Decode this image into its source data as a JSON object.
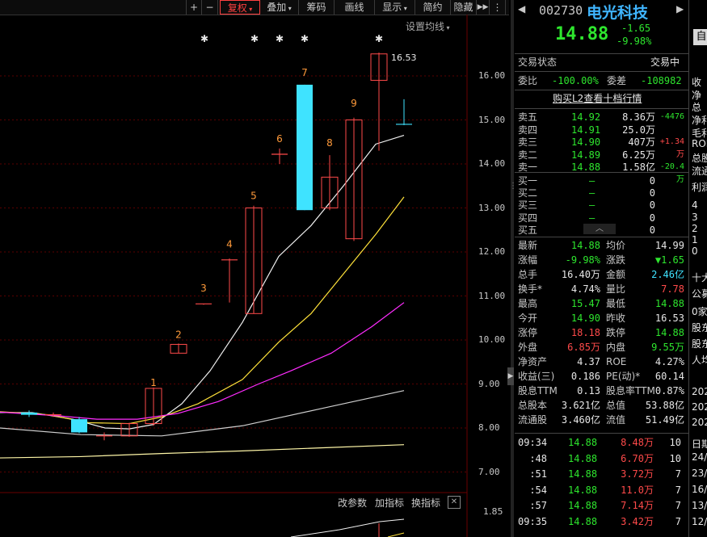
{
  "toolbar": {
    "plus": "+",
    "minus": "−",
    "fuquan": "复权",
    "diejia": "叠加",
    "chouma": "筹码",
    "huaxian": "画线",
    "xianshi": "显示",
    "jianyue": "简约",
    "yincang": "隐藏",
    "nav": "▶▶",
    "more": "⋮"
  },
  "chart": {
    "setting_ma": "设置均线",
    "price_ticks": [
      "16.00",
      "15.00",
      "14.00",
      "13.00",
      "12.00",
      "11.00",
      "10.00",
      "9.00",
      "8.00",
      "7.00"
    ],
    "high_label": "16.53",
    "candle_numbers": [
      "1",
      "2",
      "3",
      "4",
      "5",
      "6",
      "7",
      "8",
      "9"
    ],
    "star": "✱",
    "bottom_tools": {
      "gaicanshu": "改参数",
      "jiazhibiao": "加指标",
      "huanzhibiao": "换指标",
      "close": "✕"
    },
    "indicator_tick": "1.85"
  },
  "stock": {
    "code": "002730",
    "name": "电光科技",
    "price": "14.88",
    "change": "-1.65",
    "pct": "-9.98%",
    "side_btn": "自"
  },
  "status": {
    "label": "交易状态",
    "value": "交易中"
  },
  "weibi": {
    "label": "委比",
    "value": "-100.00%",
    "label2": "委差",
    "value2": "-108982"
  },
  "l2_link": "购买L2查看十档行情",
  "sell": [
    {
      "label": "卖五",
      "price": "14.92",
      "vol": "8.36万",
      "chg": "-4476"
    },
    {
      "label": "卖四",
      "price": "14.91",
      "vol": "25.0万",
      "chg": ""
    },
    {
      "label": "卖三",
      "price": "14.90",
      "vol": "407万",
      "chg": "+1.34万"
    },
    {
      "label": "卖二",
      "price": "14.89",
      "vol": "6.25万",
      "chg": ""
    },
    {
      "label": "卖一",
      "price": "14.88",
      "vol": "1.58亿",
      "chg": "-20.4万"
    }
  ],
  "buy": [
    {
      "label": "买一",
      "price": "—",
      "vol": "0"
    },
    {
      "label": "买二",
      "price": "—",
      "vol": "0"
    },
    {
      "label": "买三",
      "price": "—",
      "vol": "0"
    },
    {
      "label": "买四",
      "price": "—",
      "vol": "0"
    },
    {
      "label": "买五",
      "price": "—",
      "vol": "0"
    }
  ],
  "quote": [
    {
      "l1": "最新",
      "v1": "14.88",
      "c1": "green",
      "l2": "均价",
      "v2": "14.99",
      "c2": "white"
    },
    {
      "l1": "涨幅",
      "v1": "-9.98%",
      "c1": "green",
      "l2": "涨跌",
      "v2": "▼1.65",
      "c2": "green"
    },
    {
      "l1": "总手",
      "v1": "16.40万",
      "c1": "white",
      "l2": "金额",
      "v2": "2.46亿",
      "c2": "cyan"
    },
    {
      "l1": "换手*",
      "v1": "4.74%",
      "c1": "white",
      "l2": "量比",
      "v2": "7.78",
      "c2": "red"
    },
    {
      "l1": "最高",
      "v1": "15.47",
      "c1": "green",
      "l2": "最低",
      "v2": "14.88",
      "c2": "green"
    },
    {
      "l1": "今开",
      "v1": "14.90",
      "c1": "green",
      "l2": "昨收",
      "v2": "16.53",
      "c2": "white"
    },
    {
      "l1": "涨停",
      "v1": "18.18",
      "c1": "red",
      "l2": "跌停",
      "v2": "14.88",
      "c2": "green"
    },
    {
      "l1": "外盘",
      "v1": "6.85万",
      "c1": "red",
      "l2": "内盘",
      "v2": "9.55万",
      "c2": "green"
    },
    {
      "l1": "净资产",
      "v1": "4.37",
      "c1": "white",
      "l2": "ROE",
      "v2": "4.27%",
      "c2": "white"
    },
    {
      "l1": "收益(三)",
      "v1": "0.186",
      "c1": "white",
      "l2": "PE(动)*",
      "v2": "60.14",
      "c2": "white"
    },
    {
      "l1": "股息TTM",
      "v1": "0.13",
      "c1": "white",
      "l2": "股息率TTM",
      "v2": "0.87%",
      "c2": "white"
    },
    {
      "l1": "总股本",
      "v1": "3.621亿",
      "c1": "white",
      "l2": "总值",
      "v2": "53.88亿",
      "c2": "white"
    },
    {
      "l1": "流通股",
      "v1": "3.460亿",
      "c1": "white",
      "l2": "流值",
      "v2": "51.49亿",
      "c2": "white"
    }
  ],
  "ticks": [
    {
      "time": "09:34",
      "price": "14.88",
      "vol": "8.48万",
      "n": "10"
    },
    {
      "time": ":48",
      "price": "14.88",
      "vol": "6.70万",
      "n": "10"
    },
    {
      "time": ":51",
      "price": "14.88",
      "vol": "3.72万",
      "n": "7"
    },
    {
      "time": ":54",
      "price": "14.88",
      "vol": "11.0万",
      "n": "7"
    },
    {
      "time": ":57",
      "price": "14.88",
      "vol": "7.14万",
      "n": "7"
    },
    {
      "time": "09:35",
      "price": "14.88",
      "vol": "3.42万",
      "n": "7"
    }
  ],
  "right_edge": [
    "收",
    "净",
    "总",
    "净利",
    "毛利",
    "ROE",
    "总股",
    "流通",
    "利润",
    "4",
    "3",
    "2",
    "1",
    "0",
    "十大",
    "公募",
    "0家",
    "股东",
    "股东",
    "人均",
    "202",
    "202",
    "202",
    "日期",
    "24/",
    "23/",
    "16/",
    "13/",
    "12/"
  ]
}
